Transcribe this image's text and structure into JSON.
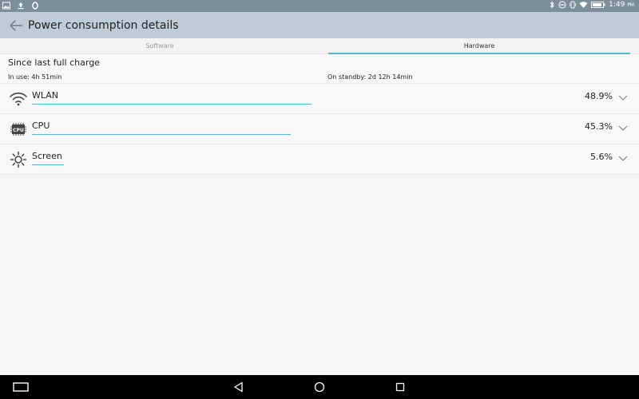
{
  "status_bar": {
    "time": "1:49",
    "ampm": "PM",
    "left_icons": [
      "image-icon",
      "upload-icon",
      "opera-icon"
    ],
    "right_icons": [
      "bluetooth-icon",
      "do-not-disturb-icon",
      "vibrate-icon",
      "wifi-icon",
      "battery-icon"
    ]
  },
  "app_bar": {
    "title": "Power consumption details"
  },
  "tabs": [
    {
      "label": "Software",
      "selected": false
    },
    {
      "label": "Hardware",
      "selected": true
    }
  ],
  "summary": {
    "heading": "Since last full charge",
    "in_use": "In use: 4h 51min",
    "on_standby": "On standby: 2d 12h 14min"
  },
  "items": [
    {
      "label": "WLAN",
      "percent": "48.9%",
      "value": 48.9,
      "icon": "wifi-icon"
    },
    {
      "label": "CPU",
      "percent": "45.3%",
      "value": 45.3,
      "icon": "cpu-icon"
    },
    {
      "label": "Screen",
      "percent": "5.6%",
      "value": 5.6,
      "icon": "brightness-icon"
    }
  ],
  "colors": {
    "accent": "#52b6d6",
    "app_bar": "#bdccd6",
    "status_bar": "#7c8f99"
  }
}
